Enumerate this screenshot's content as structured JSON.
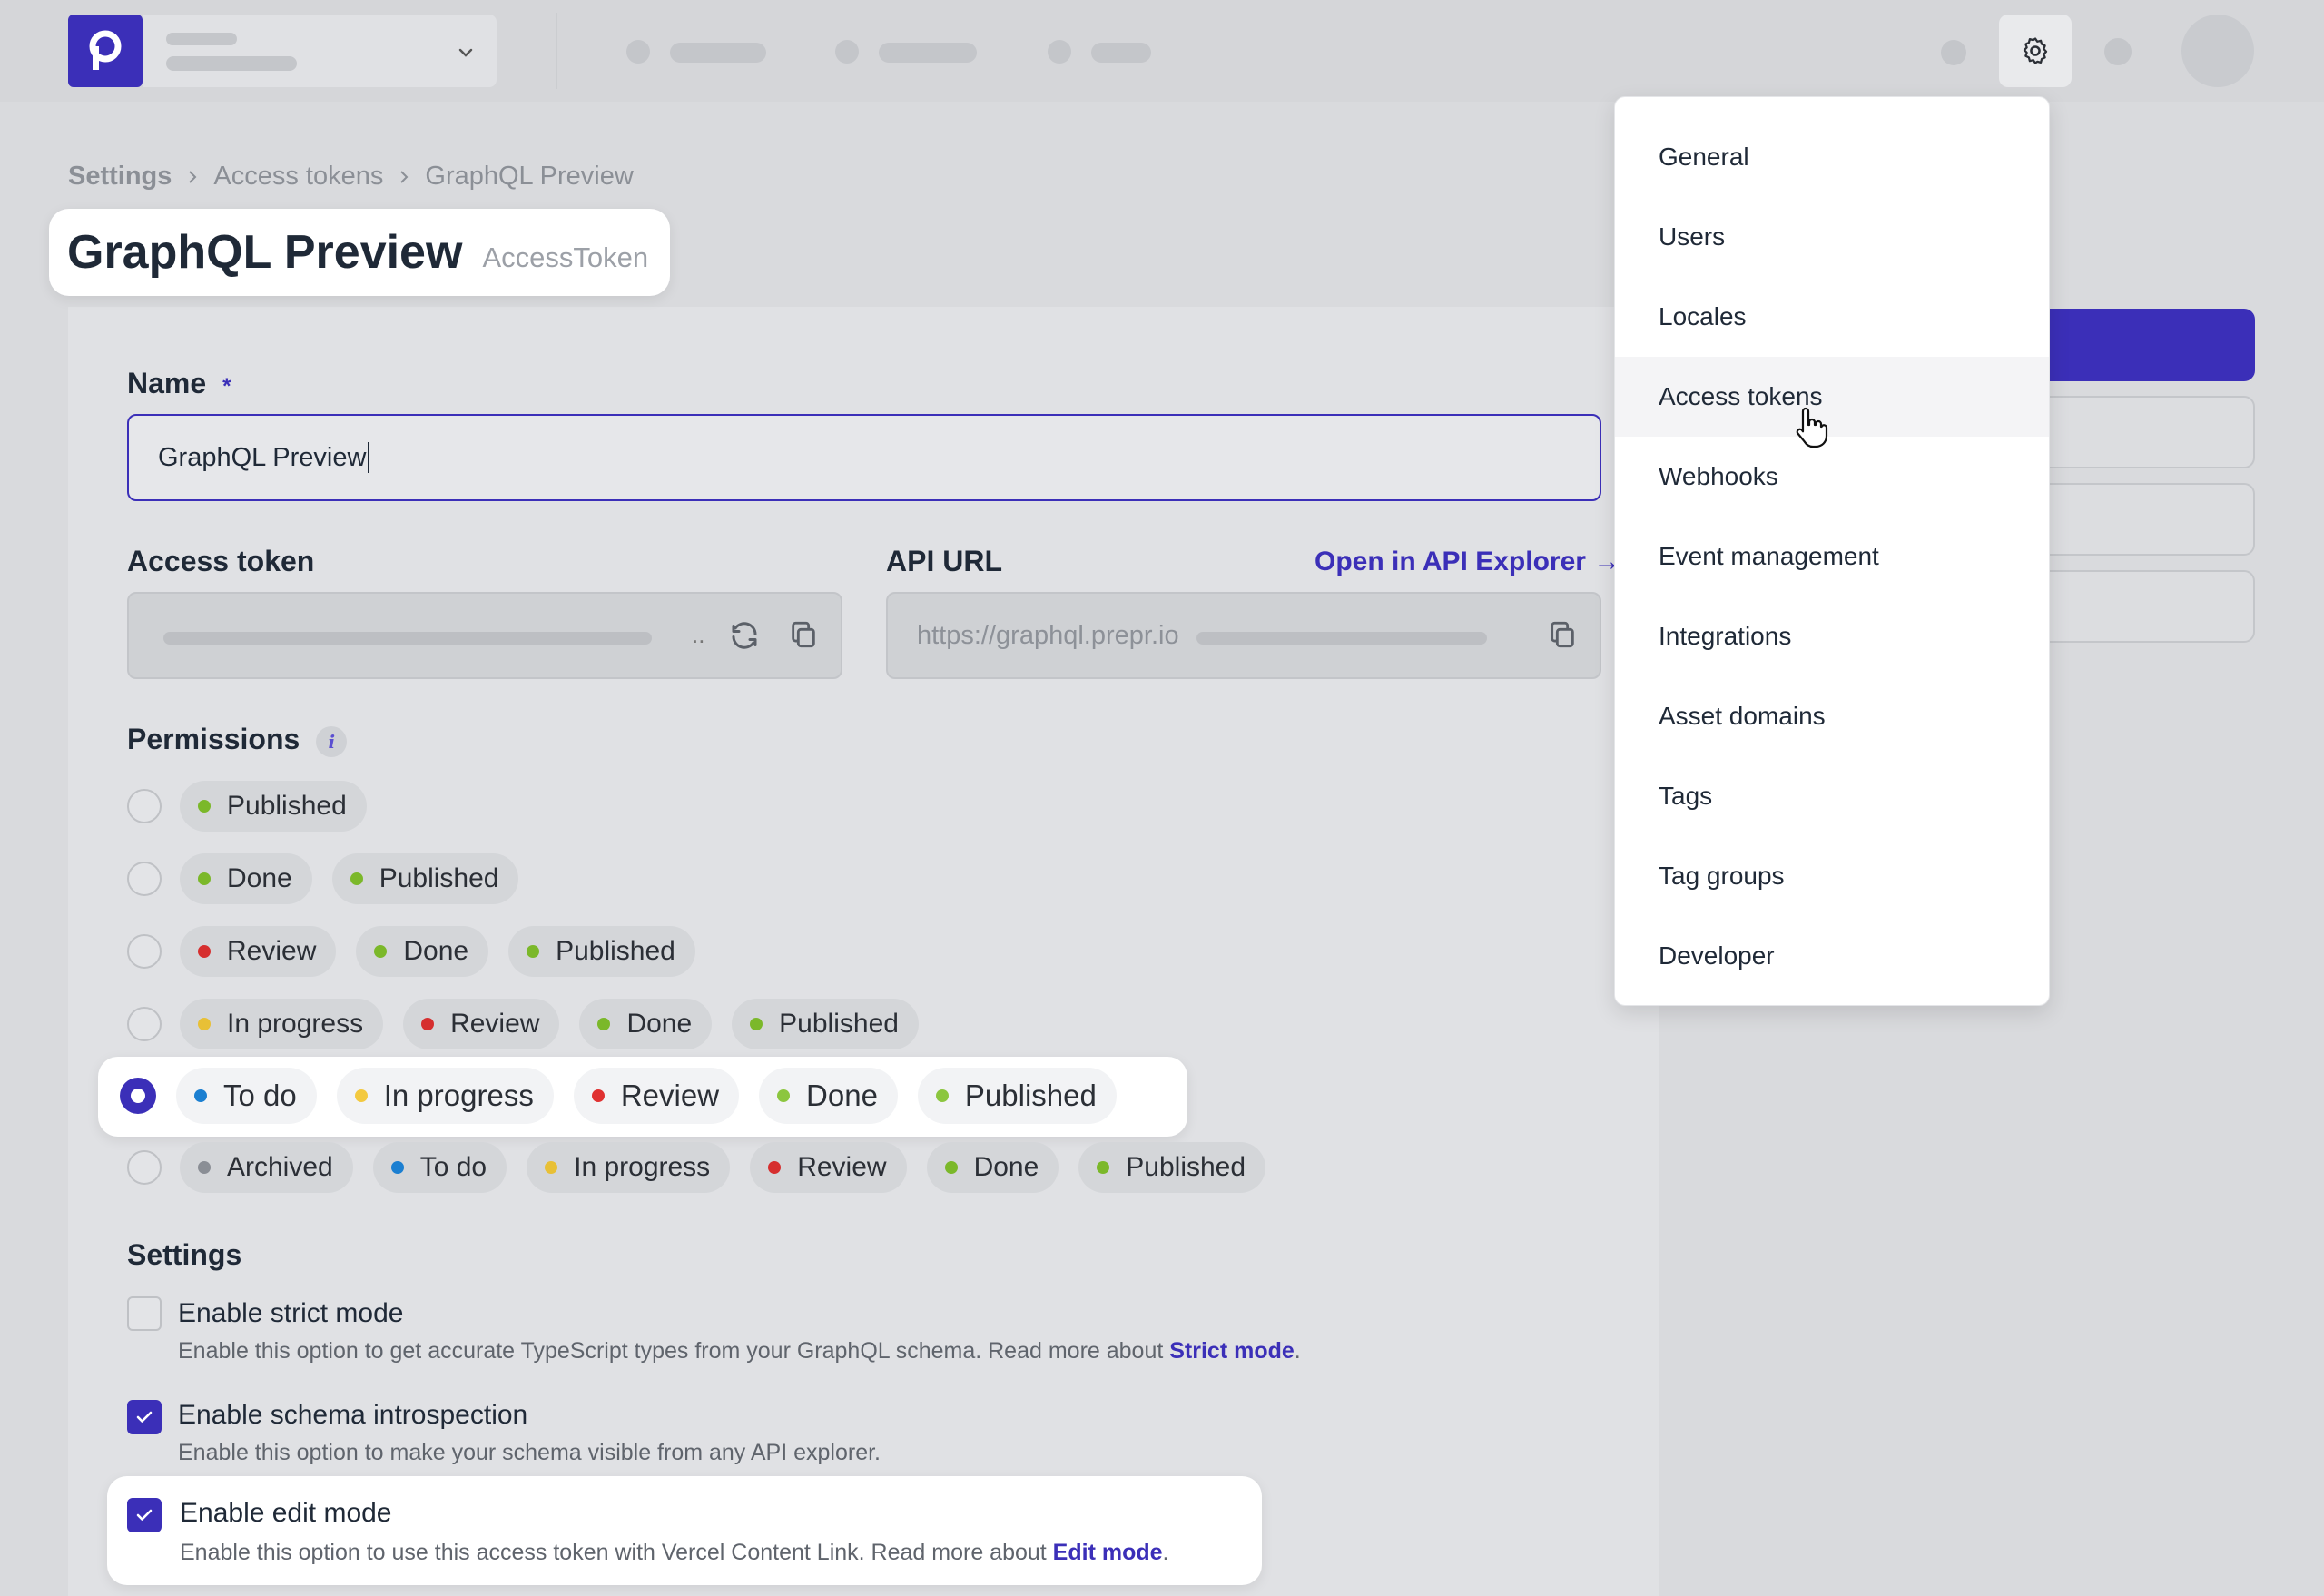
{
  "breadcrumb": [
    "Settings",
    "Access tokens",
    "GraphQL Preview"
  ],
  "page": {
    "title": "GraphQL Preview",
    "subtitle": "AccessToken"
  },
  "form": {
    "name_label": "Name",
    "name_required": "*",
    "name_value": "GraphQL Preview",
    "access_token_label": "Access token",
    "access_token_ellipsis": "..",
    "api_url_label": "API URL",
    "api_url_link": "Open in API Explorer →",
    "api_url_value": "https://graphql.prepr.io",
    "permissions_label": "Permissions",
    "permissions_info": "i"
  },
  "permissions": [
    {
      "selected": false,
      "stages": [
        {
          "label": "Published",
          "color": "#7bb82a"
        }
      ]
    },
    {
      "selected": false,
      "stages": [
        {
          "label": "Done",
          "color": "#7bb82a"
        },
        {
          "label": "Published",
          "color": "#7bb82a"
        }
      ]
    },
    {
      "selected": false,
      "stages": [
        {
          "label": "Review",
          "color": "#d62f2f"
        },
        {
          "label": "Done",
          "color": "#7bb82a"
        },
        {
          "label": "Published",
          "color": "#7bb82a"
        }
      ]
    },
    {
      "selected": false,
      "stages": [
        {
          "label": "In progress",
          "color": "#e8c036"
        },
        {
          "label": "Review",
          "color": "#d62f2f"
        },
        {
          "label": "Done",
          "color": "#7bb82a"
        },
        {
          "label": "Published",
          "color": "#7bb82a"
        }
      ]
    },
    {
      "selected": true,
      "stages": [
        {
          "label": "To do",
          "color": "#1b7fd1"
        },
        {
          "label": "In progress",
          "color": "#f3c940"
        },
        {
          "label": "Review",
          "color": "#e03131"
        },
        {
          "label": "Done",
          "color": "#8cc63f"
        },
        {
          "label": "Published",
          "color": "#8cc63f"
        }
      ]
    },
    {
      "selected": false,
      "stages": [
        {
          "label": "Archived",
          "color": "#8a8e95"
        },
        {
          "label": "To do",
          "color": "#1b7fd1"
        },
        {
          "label": "In progress",
          "color": "#e8c036"
        },
        {
          "label": "Review",
          "color": "#d62f2f"
        },
        {
          "label": "Done",
          "color": "#7bb82a"
        },
        {
          "label": "Published",
          "color": "#7bb82a"
        }
      ]
    }
  ],
  "settings": {
    "heading": "Settings",
    "strict": {
      "checked": false,
      "title": "Enable strict mode",
      "desc": "Enable this option to get accurate TypeScript types from your GraphQL schema. Read more about ",
      "link": "Strict mode",
      "end": "."
    },
    "introspection": {
      "checked": true,
      "title": "Enable schema introspection",
      "desc": "Enable this option to make your schema visible from any API explorer."
    },
    "edit": {
      "checked": true,
      "title": "Enable edit mode",
      "desc": "Enable this option to use this access token with Vercel Content Link. Read more about ",
      "link": "Edit mode",
      "end": "."
    }
  },
  "menu": {
    "items": [
      "General",
      "Users",
      "Locales",
      "Access tokens",
      "Webhooks",
      "Event management",
      "Integrations",
      "Asset domains",
      "Tags",
      "Tag groups",
      "Developer"
    ],
    "hovered": "Access tokens"
  },
  "colors": {
    "accent": "#3b2fb8"
  }
}
